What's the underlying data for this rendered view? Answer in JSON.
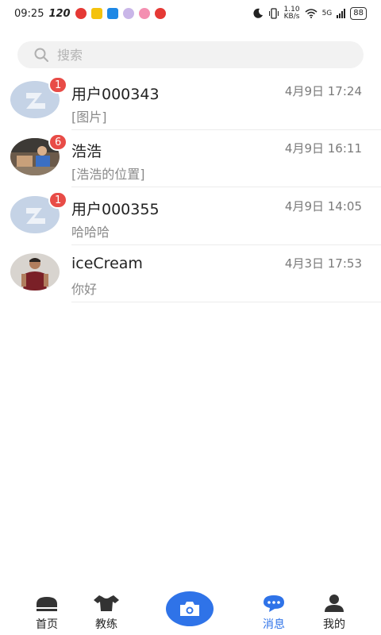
{
  "status_bar": {
    "time": "09:25",
    "refresh_rate": "120",
    "network_speed": "1.10",
    "network_unit": "KB/s",
    "network_type": "5G",
    "battery": "88"
  },
  "search": {
    "placeholder": "搜索"
  },
  "conversations": [
    {
      "name": "用户000343",
      "time": "4月9日 17:24",
      "message": "[图片]",
      "badge": "1",
      "avatar": "default-avatar"
    },
    {
      "name": "浩浩",
      "time": "4月9日 16:11",
      "message": "[浩浩的位置]",
      "badge": "6",
      "avatar": "photo-avatar-group"
    },
    {
      "name": "用户000355",
      "time": "4月9日 14:05",
      "message": "哈哈哈",
      "badge": "1",
      "avatar": "default-avatar"
    },
    {
      "name": "iceCream",
      "time": "4月3日 17:53",
      "message": "你好",
      "badge": "",
      "avatar": "photo-avatar-man"
    }
  ],
  "tabs": [
    {
      "label": "首页",
      "icon": "home-icon"
    },
    {
      "label": "教练",
      "icon": "coach-icon"
    },
    {
      "label": "",
      "icon": "camera-icon"
    },
    {
      "label": "消息",
      "icon": "message-icon",
      "active": true
    },
    {
      "label": "我的",
      "icon": "profile-icon"
    }
  ],
  "colors": {
    "accent": "#2f73e8",
    "badge": "#e84c47",
    "muted_text": "#8a8a8a"
  }
}
